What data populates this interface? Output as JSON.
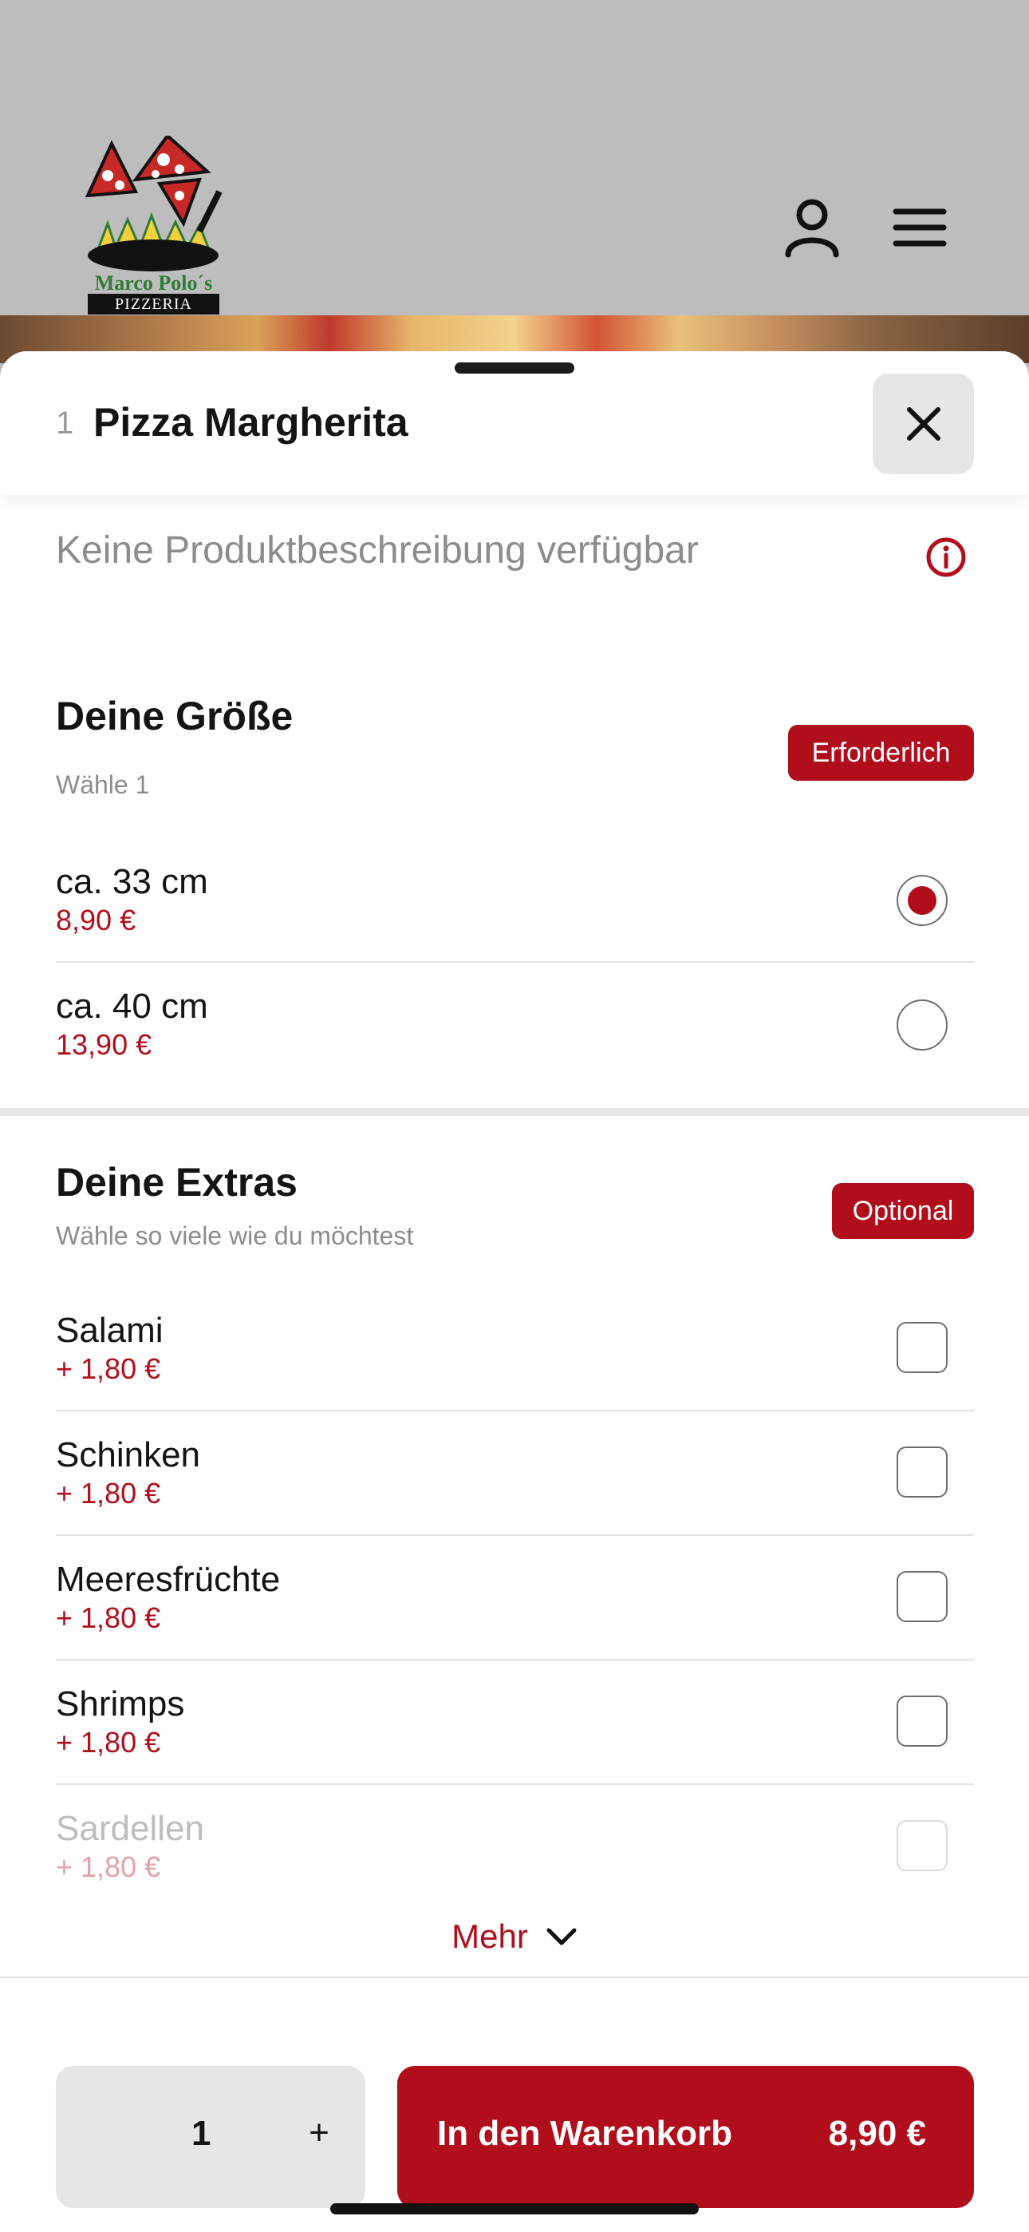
{
  "header": {
    "logo_title": "Marco Polo´s",
    "logo_subtitle": "PIZZERIA",
    "icons": [
      "user-icon",
      "menu-icon"
    ]
  },
  "product": {
    "quantity_prefix": "1",
    "name": "Pizza Margherita",
    "description": "Keine Produktbeschreibung verfügbar"
  },
  "size_section": {
    "title": "Deine Größe",
    "subtitle": "Wähle 1",
    "badge": "Erforderlich",
    "options": [
      {
        "name": "ca. 33 cm",
        "price": "8,90 €",
        "selected": true
      },
      {
        "name": "ca. 40 cm",
        "price": "13,90 €",
        "selected": false
      }
    ]
  },
  "extras_section": {
    "title": "Deine Extras",
    "subtitle": "Wähle so viele wie du möchtest",
    "badge": "Optional",
    "options": [
      {
        "name": "Salami",
        "price": "+ 1,80 €",
        "checked": false
      },
      {
        "name": "Schinken",
        "price": "+ 1,80 €",
        "checked": false
      },
      {
        "name": "Meeresfrüchte",
        "price": "+ 1,80 €",
        "checked": false
      },
      {
        "name": "Shrimps",
        "price": "+ 1,80 €",
        "checked": false
      },
      {
        "name": "Sardellen",
        "price": "+ 1,80 €",
        "checked": false
      }
    ],
    "more_label": "Mehr"
  },
  "footer": {
    "quantity": "1",
    "plus": "+",
    "cart_label": "In den Warenkorb",
    "cart_price": "8,90 €"
  },
  "colors": {
    "accent": "#b10e1c",
    "background": "#ffffff",
    "header_bg": "#bdbdbd"
  }
}
